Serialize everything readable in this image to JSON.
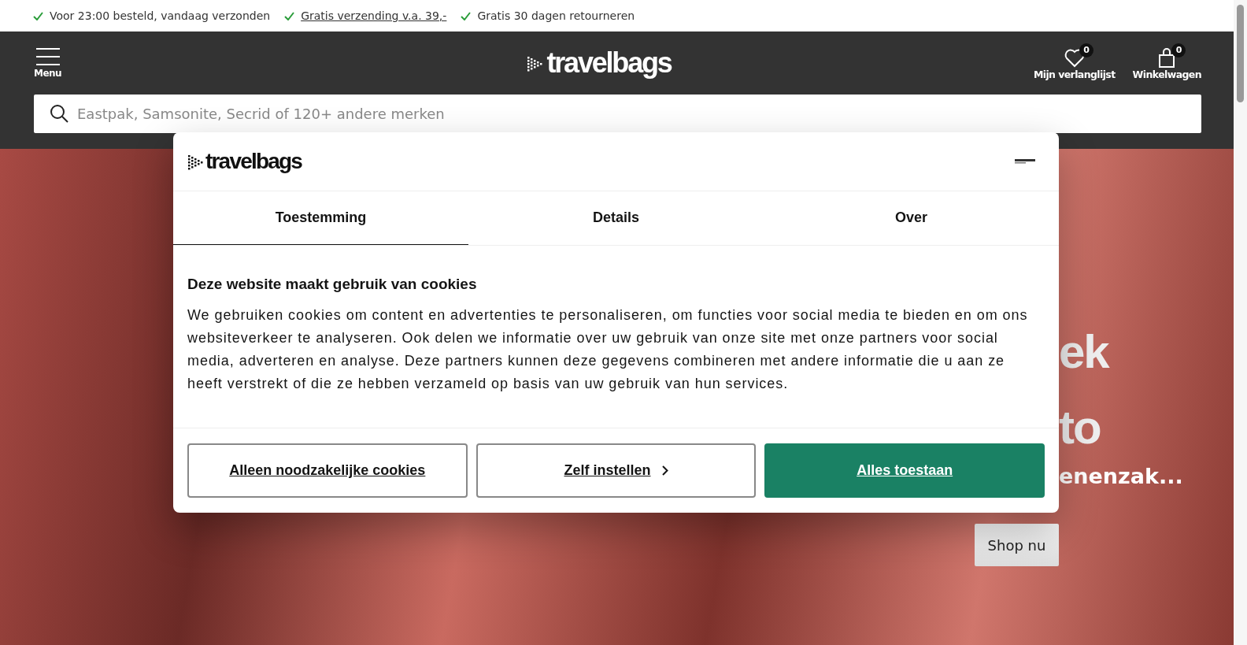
{
  "usp_bar": [
    {
      "text": "Voor 23:00 besteld, vandaag verzonden",
      "link": false
    },
    {
      "text": "Gratis verzending v.a. 39,-",
      "link": true
    },
    {
      "text": "Gratis 30 dagen retourneren",
      "link": false
    }
  ],
  "header": {
    "menu_label": "Menu",
    "logo": "travelbags",
    "wishlist": {
      "label": "Mijn verlanglijst",
      "count": "0"
    },
    "cart": {
      "label": "Winkelwagen",
      "count": "0"
    }
  },
  "search": {
    "placeholder": "Eastpak, Samsonite, Secrid of 120+ andere merken"
  },
  "hero": {
    "lines": [
      "ek",
      "to"
    ],
    "subtitle": "enenzak...",
    "button": "Shop nu"
  },
  "cookie_dialog": {
    "logo": "travelbags",
    "tabs": [
      {
        "label": "Toestemming",
        "selected": true
      },
      {
        "label": "Details",
        "selected": false
      },
      {
        "label": "Over",
        "selected": false
      }
    ],
    "heading": "Deze website maakt gebruik van cookies",
    "body": "We gebruiken cookies om content en advertenties te personaliseren, om functies voor social media te bieden en om ons websiteverkeer te analyseren. Ook delen we informatie over uw gebruik van onze site met onze partners voor social media, adverteren en analyse. Deze partners kunnen deze gegevens combineren met andere informatie die u aan ze heeft verstrekt of die ze hebben verzameld op basis van uw gebruik van hun services.",
    "buttons": [
      {
        "label": "Alleen noodzakelijke cookies",
        "kind": "outline"
      },
      {
        "label": "Zelf instellen",
        "kind": "chevron"
      },
      {
        "label": "Alles toestaan",
        "kind": "primary"
      }
    ]
  }
}
